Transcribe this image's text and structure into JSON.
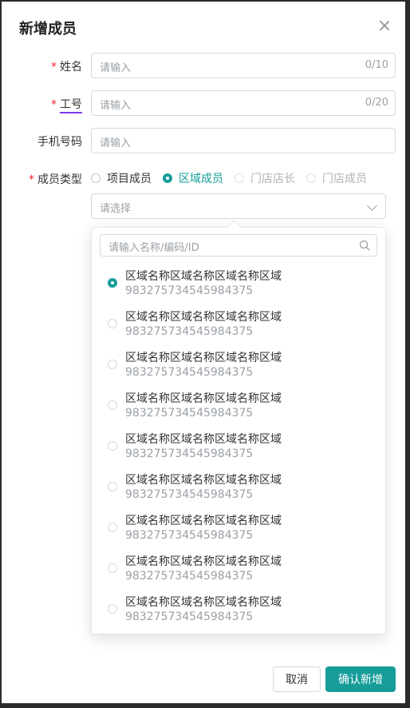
{
  "dialog": {
    "title": "新增成员",
    "fields": {
      "name": {
        "label": "姓名",
        "placeholder": "请输入",
        "counter": "0/10",
        "required_mark": "*"
      },
      "employee_id": {
        "label": "工号",
        "placeholder": "请输入",
        "counter": "0/20",
        "required_mark": "*"
      },
      "phone": {
        "label": "手机号码",
        "placeholder": "请输入"
      },
      "member_type": {
        "label": "成员类型",
        "required_mark": "*",
        "options": [
          {
            "label": "项目成员",
            "state": "unselected"
          },
          {
            "label": "区域成员",
            "state": "selected"
          },
          {
            "label": "门店店长",
            "state": "disabled"
          },
          {
            "label": "门店成员",
            "state": "disabled"
          }
        ]
      }
    },
    "region_select": {
      "placeholder": "请选择",
      "dropdown": {
        "search_placeholder": "请输入名称/编码/ID",
        "items": [
          {
            "name": "区域名称区域名称区域名称区域",
            "id": "983275734545984375",
            "selected": true
          },
          {
            "name": "区域名称区域名称区域名称区域",
            "id": "983275734545984375",
            "selected": false
          },
          {
            "name": "区域名称区域名称区域名称区域",
            "id": "983275734545984375",
            "selected": false
          },
          {
            "name": "区域名称区域名称区域名称区域",
            "id": "983275734545984375",
            "selected": false
          },
          {
            "name": "区域名称区域名称区域名称区域",
            "id": "983275734545984375",
            "selected": false
          },
          {
            "name": "区域名称区域名称区域名称区域",
            "id": "983275734545984375",
            "selected": false
          },
          {
            "name": "区域名称区域名称区域名称区域",
            "id": "983275734545984375",
            "selected": false
          },
          {
            "name": "区域名称区域名称区域名称区域",
            "id": "983275734545984375",
            "selected": false
          },
          {
            "name": "区域名称区域名称区域名称区域",
            "id": "983275734545984375",
            "selected": false
          }
        ]
      }
    },
    "buttons": {
      "cancel": "取消",
      "confirm": "确认新增"
    },
    "colors": {
      "accent": "#169d9a",
      "required": "#f5222d",
      "underline": "#7c3aed"
    },
    "icons": {
      "close": "close-icon",
      "search": "search-icon",
      "chevron": "chevron-down-icon"
    }
  }
}
